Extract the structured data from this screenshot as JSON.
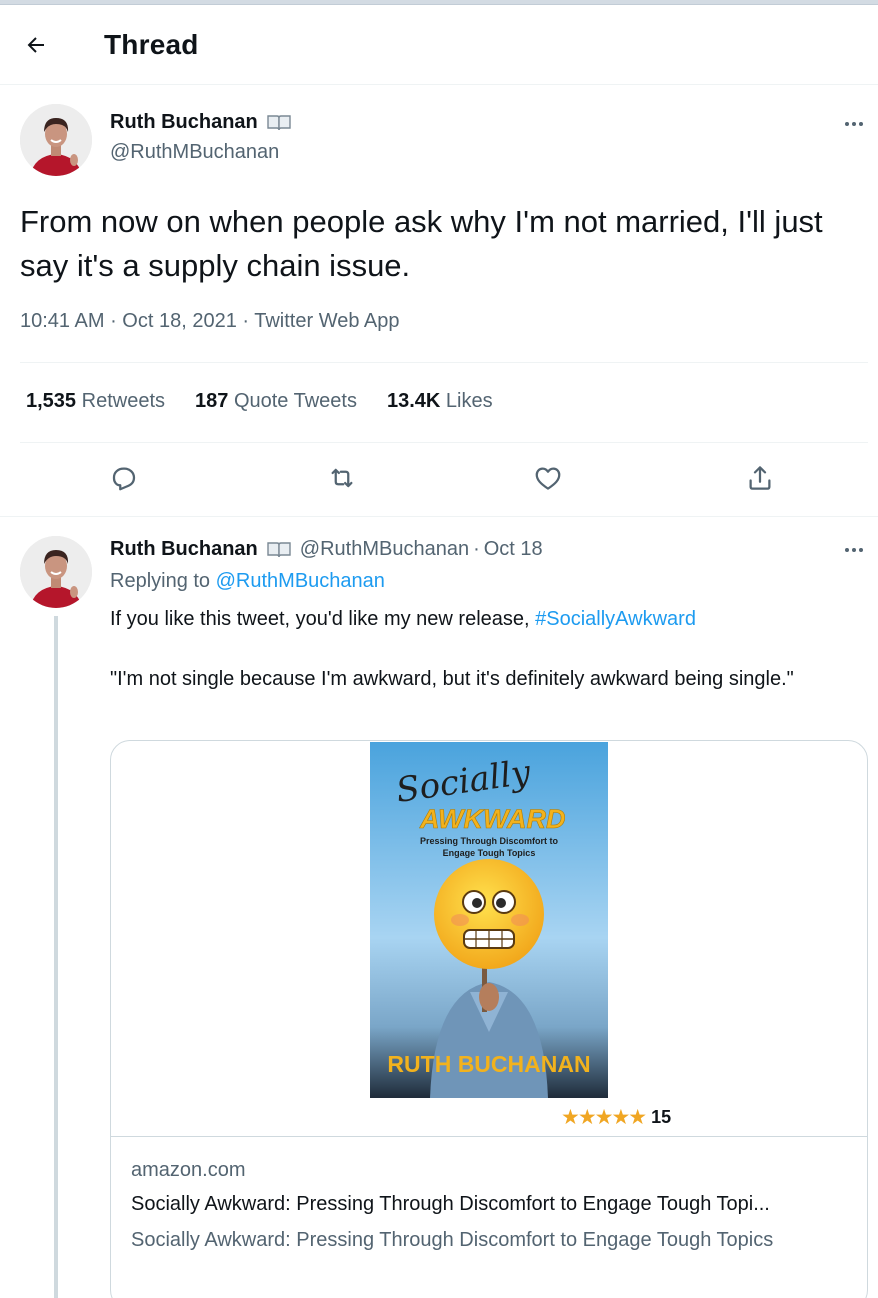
{
  "header": {
    "title": "Thread"
  },
  "main_tweet": {
    "name": "Ruth Buchanan",
    "handle": "@RuthMBuchanan",
    "text": "From now on when people ask why I'm not married, I'll just say it's a supply chain issue.",
    "time": "10:41 AM",
    "date": "Oct 18, 2021",
    "source": "Twitter Web App",
    "stats": {
      "retweets_count": "1,535",
      "retweets_label": "Retweets",
      "quotes_count": "187",
      "quotes_label": "Quote Tweets",
      "likes_count": "13.4K",
      "likes_label": "Likes"
    },
    "icons": [
      "reply-icon",
      "retweet-icon",
      "like-icon",
      "share-icon"
    ]
  },
  "reply_tweet": {
    "name": "Ruth Buchanan",
    "handle": "@RuthMBuchanan",
    "date": "Oct 18",
    "replying_label": "Replying to",
    "replying_handle": "@RuthMBuchanan",
    "text_line1": "If you like this tweet, you'd like my new release,",
    "hashtag": "#SociallyAwkward",
    "text_quote": "\"I'm not single because I'm awkward, but it's definitely awkward being single.\"",
    "card": {
      "book_script_title": "Socially",
      "book_title": "AWKWARD",
      "book_subtitle_1": "Pressing Through Discomfort to",
      "book_subtitle_2": "Engage Tough Topics",
      "book_author": "RUTH BUCHANAN",
      "stars": "★★★★★",
      "rating_count": "15",
      "domain": "amazon.com",
      "title": "Socially Awkward: Pressing Through Discomfort to Engage Tough Topi...",
      "description": "Socially Awkward: Pressing Through Discomfort to Engage Tough Topics"
    }
  },
  "colors": {
    "accent": "#1d9bf0",
    "text": "#0f1419",
    "secondary": "#536471",
    "star": "#f0a623"
  }
}
